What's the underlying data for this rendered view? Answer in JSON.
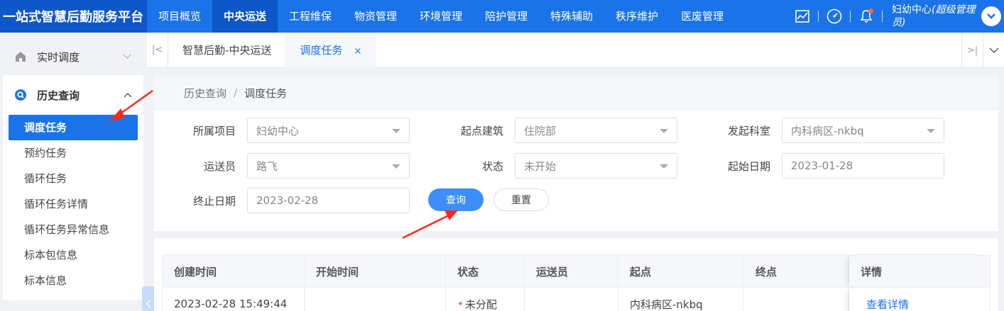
{
  "brand": "一站式智慧后勤服务平台",
  "nav": [
    {
      "label": "项目概览"
    },
    {
      "label": "中央运送",
      "active": true
    },
    {
      "label": "工程维保"
    },
    {
      "label": "物资管理"
    },
    {
      "label": "环境管理"
    },
    {
      "label": "陪护管理"
    },
    {
      "label": "特殊辅助"
    },
    {
      "label": "秩序维护"
    },
    {
      "label": "医废管理"
    }
  ],
  "user": {
    "name": "妇幼中心",
    "role": "(超级管理员)"
  },
  "sidebar": {
    "group_realtime": "实时调度",
    "group_history": "历史查询",
    "items": [
      {
        "label": "调度任务",
        "active": true
      },
      {
        "label": "预约任务"
      },
      {
        "label": "循环任务"
      },
      {
        "label": "循环任务详情"
      },
      {
        "label": "循环任务异常信息"
      },
      {
        "label": "标本包信息"
      },
      {
        "label": "标本信息"
      }
    ]
  },
  "tabs": [
    {
      "label": "智慧后勤-中央运送"
    },
    {
      "label": "调度任务",
      "active": true,
      "close": "×"
    }
  ],
  "breadcrumb": {
    "parent": "历史查询",
    "separator": "/",
    "current": "调度任务"
  },
  "filters": {
    "project_label": "所属项目",
    "project_value": "妇幼中心",
    "building_label": "起点建筑",
    "building_value": "住院部",
    "dept_label": "发起科室",
    "dept_value": "内科病区-nkbq",
    "porter_label": "运送员",
    "porter_value": "路飞",
    "status_label": "状态",
    "status_value": "未开始",
    "start_label": "起始日期",
    "start_value": "2023-01-28",
    "end_label": "终止日期",
    "end_value": "2023-02-28",
    "query_btn": "查询",
    "reset_btn": "重置"
  },
  "table": {
    "headers": [
      "创建时间",
      "开始时间",
      "状态",
      "运送员",
      "起点",
      "终点",
      "详情"
    ],
    "rows": [
      {
        "created": "2023-02-28 15:49:44",
        "started": "",
        "status": "未分配",
        "porter": "",
        "origin": "内科病区-nkbq",
        "dest": "",
        "detail": "查看详情"
      }
    ]
  },
  "colors": {
    "primary": "#1a73e8",
    "brand_bg": "#0d57c9",
    "annotation": "#ff2a1a"
  }
}
